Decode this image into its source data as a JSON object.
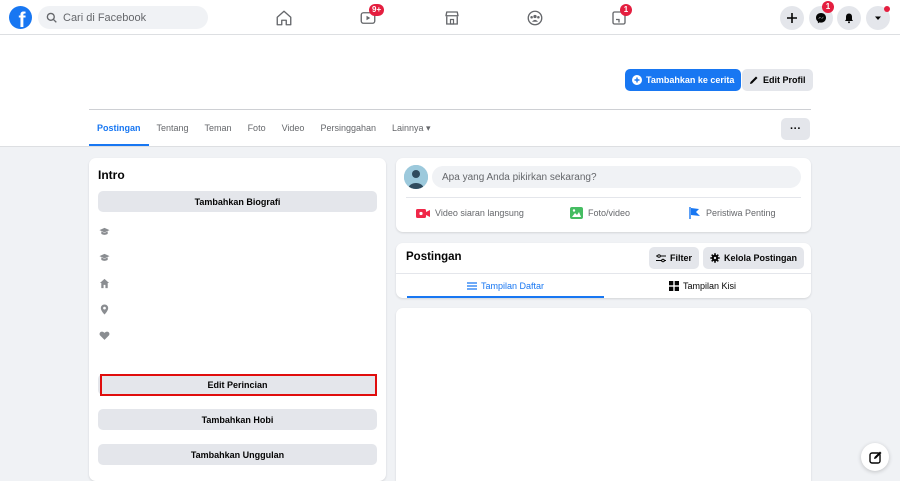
{
  "topnav": {
    "search_placeholder": "Cari di Facebook",
    "video_badge": "9+",
    "gaming_badge": "1",
    "messenger_badge": "1",
    "logo_letter": "f"
  },
  "header": {
    "add_story_label": "Tambahkan ke cerita",
    "edit_profile_label": "Edit Profil",
    "more_label": "···",
    "tabs": [
      {
        "label": "Postingan",
        "active": true
      },
      {
        "label": "Tentang"
      },
      {
        "label": "Teman"
      },
      {
        "label": "Foto"
      },
      {
        "label": "Video"
      },
      {
        "label": "Persinggahan"
      },
      {
        "label": "Lainnya ▾"
      }
    ]
  },
  "intro": {
    "title": "Intro",
    "add_bio_label": "Tambahkan Biografi",
    "edit_details_label": "Edit Perincian",
    "add_hobbies_label": "Tambahkan Hobi",
    "add_featured_label": "Tambahkan Unggulan",
    "icons": [
      "education-icon",
      "education-icon",
      "home-icon",
      "location-icon",
      "heart-icon"
    ]
  },
  "composer": {
    "placeholder": "Apa yang Anda pikirkan sekarang?",
    "live_label": "Video siaran langsung",
    "photo_label": "Foto/video",
    "life_event_label": "Peristiwa Penting"
  },
  "posts": {
    "title": "Postingan",
    "filter_label": "Filter",
    "manage_label": "Kelola Postingan",
    "list_view_label": "Tampilan Daftar",
    "grid_view_label": "Tampilan Kisi"
  },
  "colors": {
    "accent": "#1877f2",
    "badge": "#e41e3f",
    "highlight": "#e00d0d"
  }
}
